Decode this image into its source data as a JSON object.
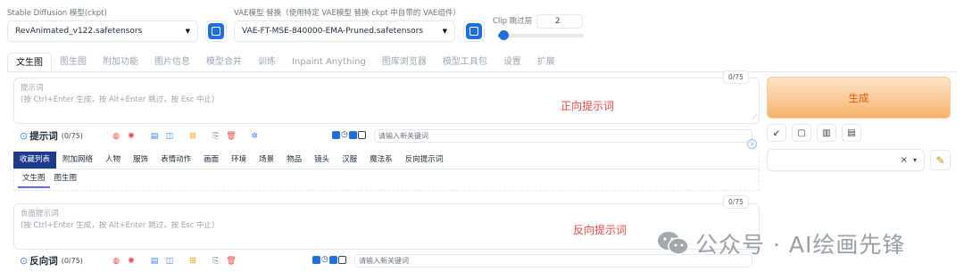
{
  "checkpoint": {
    "label": "Stable Diffusion 模型(ckpt)",
    "value": "RevAnimated_v122.safetensors"
  },
  "vae": {
    "label": "VAE模型 替换（使用特定 VAE模型 替换 ckpt 中自带的 VAE组件）",
    "value": "VAE-FT-MSE-840000-EMA-Pruned.safetensors"
  },
  "clip": {
    "label": "Clip 跳过层",
    "value": "2",
    "slider_fraction": 0.08
  },
  "tabs": [
    "文生图",
    "图生图",
    "附加功能",
    "图片信息",
    "模型合并",
    "训练",
    "Inpaint Anything",
    "图库浏览器",
    "模型工具包",
    "设置",
    "扩展"
  ],
  "prompt": {
    "placeholder_1": "提示词",
    "placeholder_2": "(按 Ctrl+Enter 生成，按 Alt+Enter 跳过，按 Esc 中止)",
    "counter": "0/75",
    "annotation": "正向提示词"
  },
  "prompt_tools": {
    "title": "提示词",
    "count": "(0/75)",
    "search_placeholder": "请输入新关键词"
  },
  "categories": [
    "收藏列表",
    "附加网络",
    "人物",
    "服饰",
    "表情动作",
    "画面",
    "环境",
    "场景",
    "物品",
    "镜头",
    "汉服",
    "魔法系",
    "反向提示词"
  ],
  "subtabs": [
    "文生图",
    "图生图"
  ],
  "negative": {
    "placeholder_1": "负面提示词",
    "placeholder_2": "(按 Ctrl+Enter 生成，按 Alt+Enter 跳过，按 Esc 中止)",
    "counter": "0/75",
    "annotation": "反向提示词"
  },
  "negative_tools": {
    "title": "反向词",
    "count": "(0/75)",
    "search_placeholder": "请输入新关键词"
  },
  "generate": {
    "label": "生成"
  },
  "style_select": {
    "clear": "×",
    "caret": "▾"
  },
  "watermark": "公众号 · AI绘画先锋",
  "colors": {
    "generate_from": "#fde4c8",
    "generate_to": "#f8b36c",
    "generate_text": "#ea580c",
    "accent_blue": "#1e6fd9",
    "category_active": "#1e3a8a",
    "annotation": "#ef4444"
  }
}
